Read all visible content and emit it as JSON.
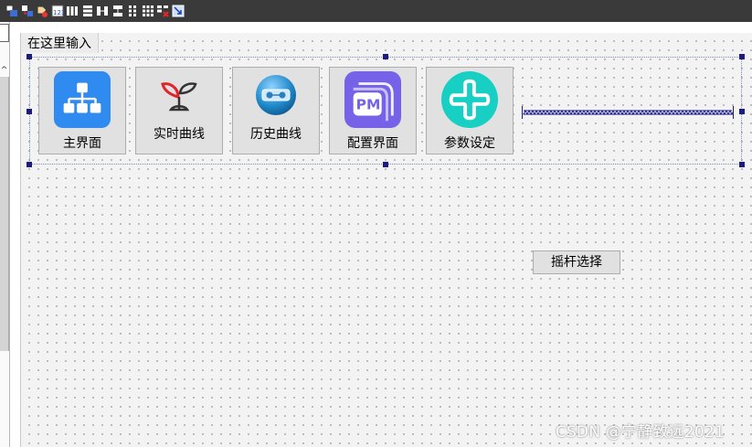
{
  "toolbar": {
    "buttons": [
      {
        "name": "edit-widgets-icon"
      },
      {
        "name": "edit-signals-slots-icon"
      },
      {
        "name": "edit-buddies-icon"
      },
      {
        "name": "edit-tab-order-icon"
      },
      {
        "name": "layout-horizontal-icon"
      },
      {
        "name": "layout-vertical-icon"
      },
      {
        "name": "layout-horizontal-splitter-icon"
      },
      {
        "name": "layout-vertical-splitter-icon"
      },
      {
        "name": "layout-form-icon"
      },
      {
        "name": "layout-grid-icon"
      },
      {
        "name": "break-layout-icon"
      },
      {
        "name": "adjust-size-icon"
      }
    ]
  },
  "form": {
    "menu_placeholder": "在这里输入",
    "buttons": [
      {
        "label": "主界面",
        "icon": "org-chart-icon",
        "color": "#2f8bf0"
      },
      {
        "label": "实时曲线",
        "icon": "sprout-icon",
        "color": "#e0242a"
      },
      {
        "label": "历史曲线",
        "icon": "tape-icon",
        "color": "#1b86c8"
      },
      {
        "label": "配置界面",
        "icon": "pm-icon",
        "color": "#7562e8"
      },
      {
        "label": "参数设定",
        "icon": "plus-swirl-icon",
        "color": "#17cfc3"
      }
    ],
    "joystick_button": "摇杆选择"
  },
  "watermark": "CSDN @宁静致远2021",
  "colors": {
    "toolbar_bg": "#3a3a3a",
    "canvas_bg": "#f3f3f3",
    "handle": "#1b1b88",
    "button_bg": "#e1e1e1"
  }
}
